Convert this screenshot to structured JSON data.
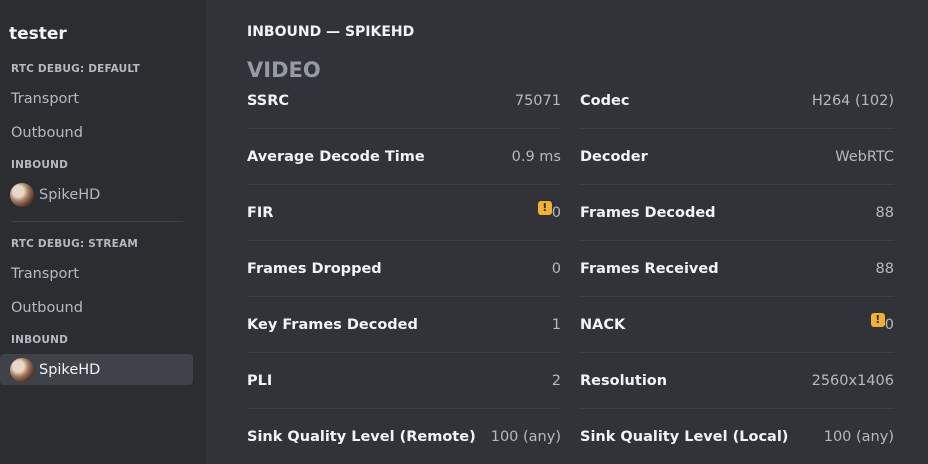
{
  "sidebar": {
    "title": "tester",
    "default_header": "RTC DEBUG: DEFAULT",
    "default_items": [
      "Transport",
      "Outbound"
    ],
    "default_inbound_header": "INBOUND",
    "default_user": "SpikeHD",
    "stream_header": "RTC DEBUG: STREAM",
    "stream_items": [
      "Transport",
      "Outbound"
    ],
    "stream_inbound_header": "INBOUND",
    "stream_user": "SpikeHD"
  },
  "main": {
    "inbound_title": "INBOUND — SPIKEHD",
    "video_title": "VIDEO",
    "left_stats": [
      {
        "label": "SSRC",
        "value": "75071"
      },
      {
        "label": "Average Decode Time",
        "value": "0.9 ms"
      },
      {
        "label": "FIR",
        "value": "0",
        "warning": true
      },
      {
        "label": "Frames Dropped",
        "value": "0"
      },
      {
        "label": "Key Frames Decoded",
        "value": "1"
      },
      {
        "label": "PLI",
        "value": "2"
      },
      {
        "label": "Sink Quality Level (Remote)",
        "value": "100 (any)"
      }
    ],
    "right_stats": [
      {
        "label": "Codec",
        "value": "H264 (102)"
      },
      {
        "label": "Decoder",
        "value": "WebRTC"
      },
      {
        "label": "Frames Decoded",
        "value": "88"
      },
      {
        "label": "Frames Received",
        "value": "88"
      },
      {
        "label": "NACK",
        "value": "0",
        "warning": true
      },
      {
        "label": "Resolution",
        "value": "2560x1406"
      },
      {
        "label": "Sink Quality Level (Local)",
        "value": "100 (any)"
      }
    ],
    "warning_glyph": "!"
  },
  "colors": {
    "background": "#313338",
    "sidebar": "#2b2d31",
    "selected": "#404249",
    "warning": "#f0b232"
  }
}
